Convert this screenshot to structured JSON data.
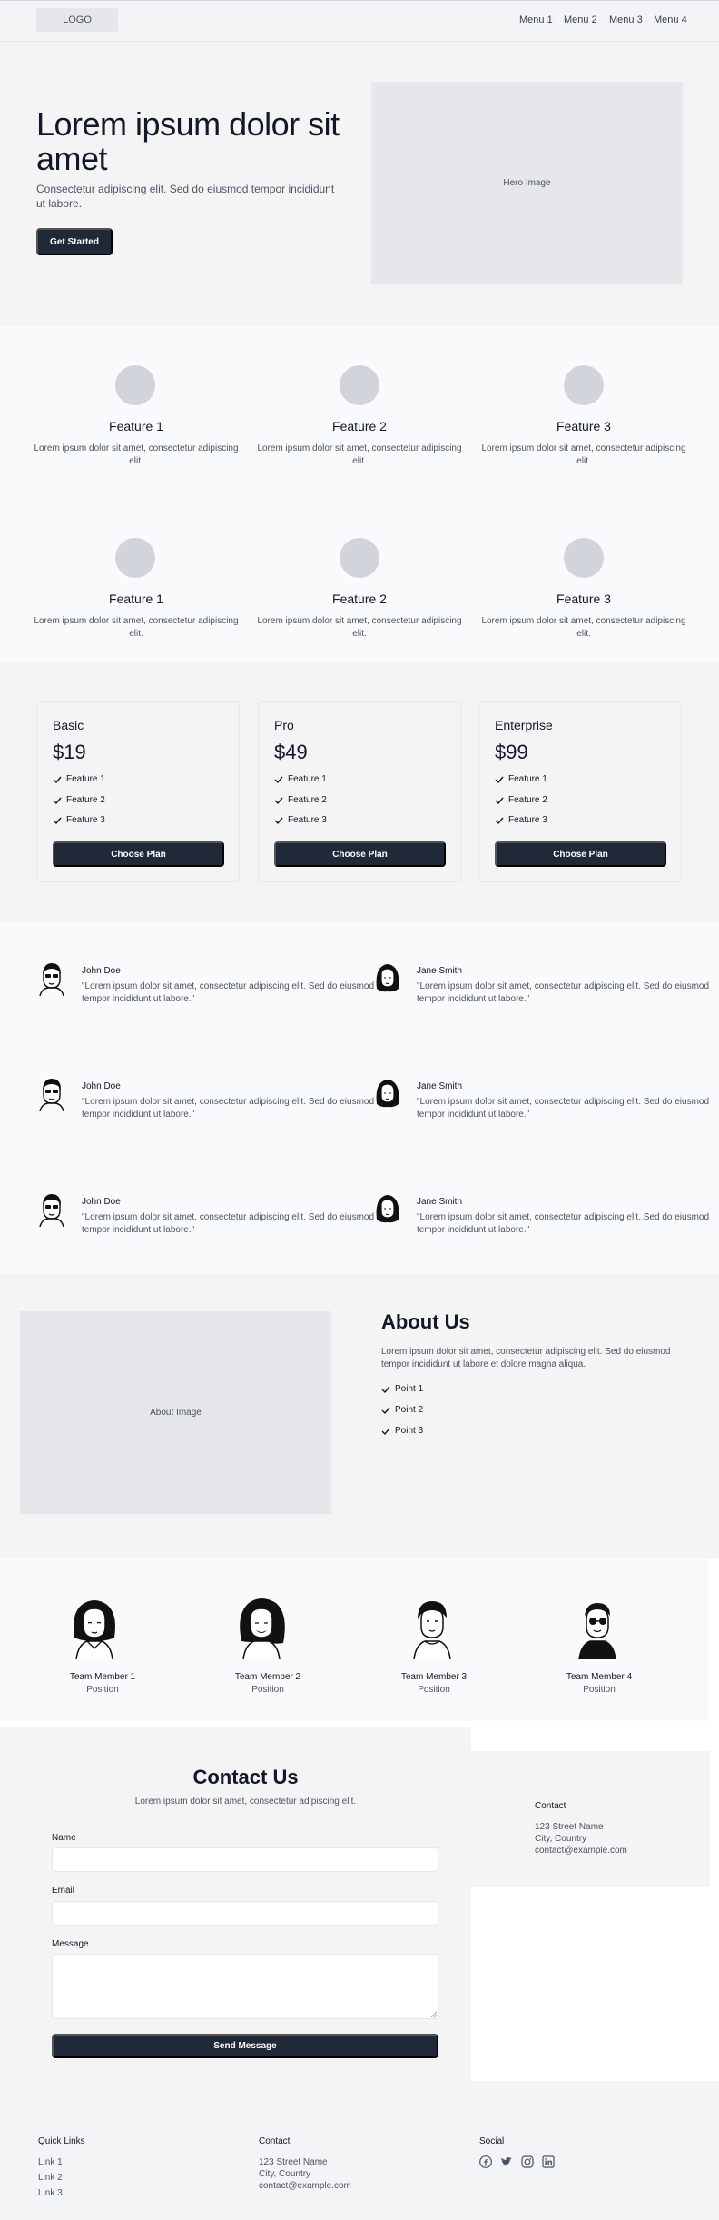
{
  "header": {
    "logo": "LOGO",
    "menu": [
      "Menu 1",
      "Menu 2",
      "Menu 3",
      "Menu 4"
    ]
  },
  "hero": {
    "title": "Lorem ipsum dolor sit amet",
    "subtitle": "Consectetur adipiscing elit. Sed do eiusmod tempor incididunt ut labore.",
    "cta": "Get Started",
    "image_label": "Hero Image"
  },
  "features": {
    "row1": [
      {
        "title": "Feature 1",
        "text": "Lorem ipsum dolor sit amet, consectetur adipiscing elit."
      },
      {
        "title": "Feature 2",
        "text": "Lorem ipsum dolor sit amet, consectetur adipiscing elit."
      },
      {
        "title": "Feature 3",
        "text": "Lorem ipsum dolor sit amet, consectetur adipiscing elit."
      }
    ],
    "row2": [
      {
        "title": "Feature 1",
        "text": "Lorem ipsum dolor sit amet, consectetur adipiscing elit."
      },
      {
        "title": "Feature 2",
        "text": "Lorem ipsum dolor sit amet, consectetur adipiscing elit."
      },
      {
        "title": "Feature 3",
        "text": "Lorem ipsum dolor sit amet, consectetur adipiscing elit."
      }
    ]
  },
  "pricing": {
    "plans": [
      {
        "name": "Basic",
        "price": "$19",
        "features": [
          "Feature 1",
          "Feature 2",
          "Feature 3"
        ],
        "button": "Choose Plan"
      },
      {
        "name": "Pro",
        "price": "$49",
        "features": [
          "Feature 1",
          "Feature 2",
          "Feature 3"
        ],
        "button": "Choose Plan"
      },
      {
        "name": "Enterprise",
        "price": "$99",
        "features": [
          "Feature 1",
          "Feature 2",
          "Feature 3"
        ],
        "button": "Choose Plan"
      }
    ]
  },
  "testimonials": [
    {
      "name": "John Doe",
      "quote": "\"Lorem ipsum dolor sit amet, consectetur adipiscing elit. Sed do eiusmod tempor incididunt ut labore.\""
    },
    {
      "name": "Jane Smith",
      "quote": "\"Lorem ipsum dolor sit amet, consectetur adipiscing elit. Sed do eiusmod tempor incididunt ut labore.\""
    },
    {
      "name": "John Doe",
      "quote": "\"Lorem ipsum dolor sit amet, consectetur adipiscing elit. Sed do eiusmod tempor incididunt ut labore.\""
    },
    {
      "name": "Jane Smith",
      "quote": "\"Lorem ipsum dolor sit amet, consectetur adipiscing elit. Sed do eiusmod tempor incididunt ut labore.\""
    },
    {
      "name": "John Doe",
      "quote": "\"Lorem ipsum dolor sit amet, consectetur adipiscing elit. Sed do eiusmod tempor incididunt ut labore.\""
    },
    {
      "name": "Jane Smith",
      "quote": "\"Lorem ipsum dolor sit amet, consectetur adipiscing elit. Sed do eiusmod tempor incididunt ut labore.\""
    }
  ],
  "about": {
    "image_label": "About Image",
    "title": "About Us",
    "text": "Lorem ipsum dolor sit amet, consectetur adipiscing elit. Sed do eiusmod tempor incididunt ut labore et dolore magna aliqua.",
    "points": [
      "Point 1",
      "Point 2",
      "Point 3"
    ]
  },
  "team": [
    {
      "name": "Team Member 1",
      "position": "Position"
    },
    {
      "name": "Team Member 2",
      "position": "Position"
    },
    {
      "name": "Team Member 3",
      "position": "Position"
    },
    {
      "name": "Team Member 4",
      "position": "Position"
    }
  ],
  "contact": {
    "title": "Contact Us",
    "subtitle": "Lorem ipsum dolor sit amet, consectetur adipiscing elit.",
    "name_label": "Name",
    "email_label": "Email",
    "message_label": "Message",
    "submit": "Send Message",
    "card": {
      "title": "Contact",
      "street": "123 Street Name",
      "city": "City, Country",
      "email": "contact@example.com"
    }
  },
  "footer": {
    "links_title": "Quick Links",
    "links": [
      "Link 1",
      "Link 2",
      "Link 3"
    ],
    "contact_title": "Contact",
    "street": "123 Street Name",
    "city": "City, Country",
    "email": "contact@example.com",
    "social_title": "Social",
    "social_icons": [
      "facebook-icon",
      "twitter-icon",
      "instagram-icon",
      "linkedin-icon"
    ]
  },
  "colors": {
    "primary_button": "#1f2937",
    "placeholder_gray": "#e5e7eb",
    "feature_circle": "#d1d5db"
  }
}
